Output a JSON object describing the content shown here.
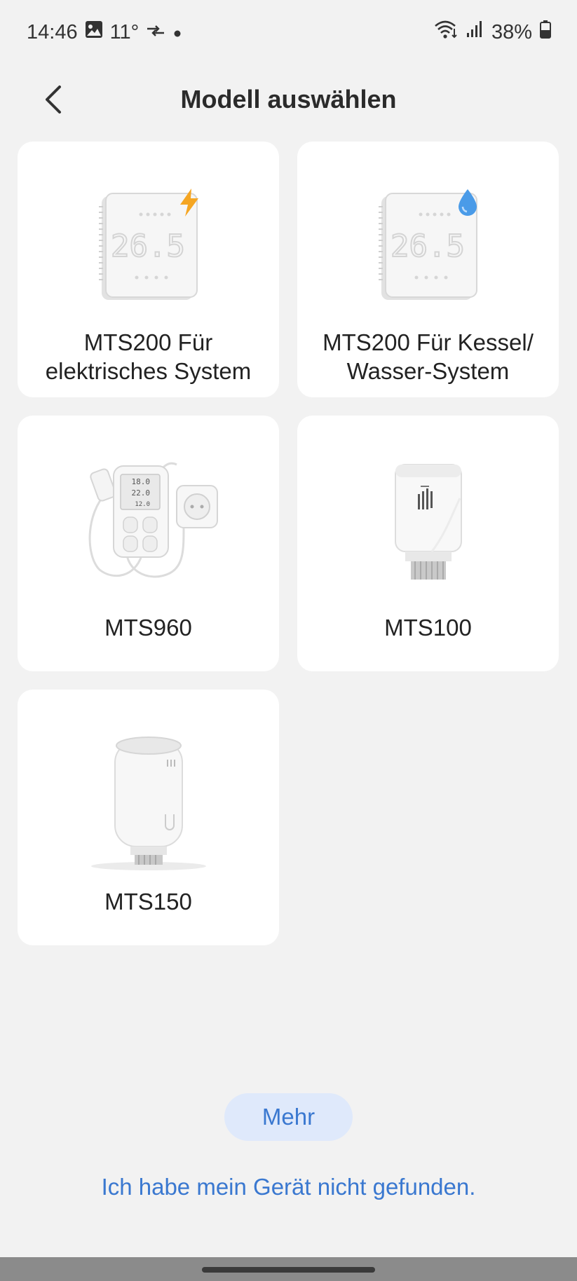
{
  "status_bar": {
    "time": "14:46",
    "temperature": "11°",
    "battery": "38%",
    "icons": [
      "gallery-icon",
      "data-transfer-icon",
      "dot-icon",
      "wifi-icon",
      "signal-icon",
      "battery-icon"
    ]
  },
  "header": {
    "title": "Modell auswählen",
    "back_icon": "chevron-left-icon"
  },
  "models": [
    {
      "line1": "MTS200 Für",
      "line2": "elektrisches System",
      "image": "thermostat-panel-bolt",
      "badge": "lightning-icon"
    },
    {
      "line1": "MTS200 Für Kessel/",
      "line2": "Wasser-System",
      "image": "thermostat-panel-drop",
      "badge": "water-drop-icon"
    },
    {
      "line1": "MTS960",
      "line2": "",
      "image": "plug-thermostat"
    },
    {
      "line1": "MTS100",
      "line2": "",
      "image": "radiator-valve"
    },
    {
      "line1": "MTS150",
      "line2": "",
      "image": "radiator-valve-round"
    }
  ],
  "panel_display": "26.5",
  "plug_display": [
    "18.0",
    "22.0",
    "12.0"
  ],
  "more_button": "Mehr",
  "not_found_link": "Ich habe mein Gerät nicht gefunden.",
  "colors": {
    "background": "#f2f2f2",
    "card": "#ffffff",
    "accent": "#3a78d0",
    "more_bg": "#dfe9fb",
    "bolt": "#f5a623",
    "drop": "#4a9be8"
  }
}
